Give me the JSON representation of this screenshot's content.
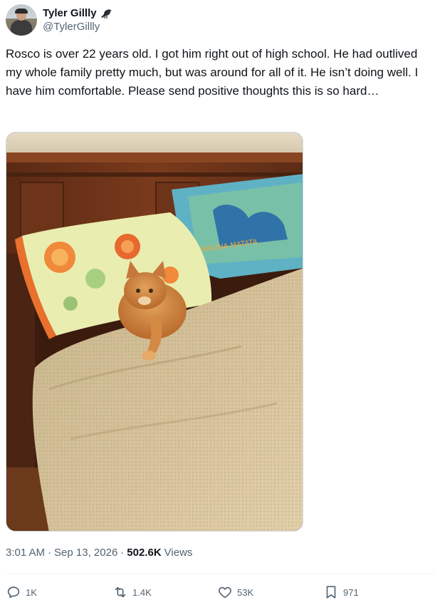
{
  "author": {
    "display_name": "Tyler Gillly",
    "handle": "@TylerGillly",
    "badge_icon": "crow-icon"
  },
  "tweet": {
    "text": "Rosco is over 22 years old. I got him right out of high school. He had outlived my whole family pretty much, but was around for all of it. He isn’t doing well. I have him comfortable. Please send positive thoughts this is so hard…",
    "image": {
      "subject": "orange-cat-on-bed",
      "pillow_print": "HAKUNA MATATA"
    }
  },
  "meta": {
    "time": "3:01 AM",
    "separator": "·",
    "date": "Sep 13, 2026",
    "views_count": "502.6K",
    "views_label": "Views"
  },
  "actions": {
    "reply": {
      "icon": "reply-icon",
      "count": "1K"
    },
    "retweet": {
      "icon": "retweet-icon",
      "count": "1.4K"
    },
    "like": {
      "icon": "heart-icon",
      "count": "53K"
    },
    "bookmark": {
      "icon": "bookmark-icon",
      "count": "971"
    }
  },
  "colors": {
    "text": "#0f1419",
    "secondary": "#536471",
    "divider": "#eff3f4"
  }
}
